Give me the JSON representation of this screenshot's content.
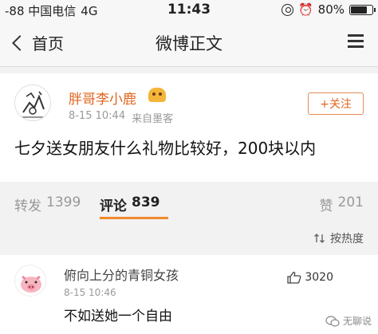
{
  "status_bar": {
    "carrier": "-88 中国电信",
    "network": "4G",
    "time": "11:43",
    "battery": "80%",
    "battery_level": 0.8
  },
  "nav": {
    "back_label": "首页",
    "title": "微博正文"
  },
  "post": {
    "author": "胖哥李小鹿",
    "date": "8-15 10:44",
    "source": "来自墨客",
    "follow_label": "+关注",
    "text": "七夕送女朋友什么礼物比较好，200块以内"
  },
  "stats": {
    "repost_label": "转发",
    "repost_count": "1399",
    "comment_label": "评论",
    "comment_count": "839",
    "like_label": "赞",
    "like_count": "201"
  },
  "sort": {
    "label": "按热度"
  },
  "comments": [
    {
      "user": "俯向上分的青铜女孩",
      "date": "8-15 10:46",
      "text": "不如送她一个自由",
      "likes": "3020"
    }
  ],
  "watermark": "无聊说",
  "colors": {
    "accent": "#e0651f",
    "underline": "#f08a2c",
    "muted": "#999999"
  }
}
